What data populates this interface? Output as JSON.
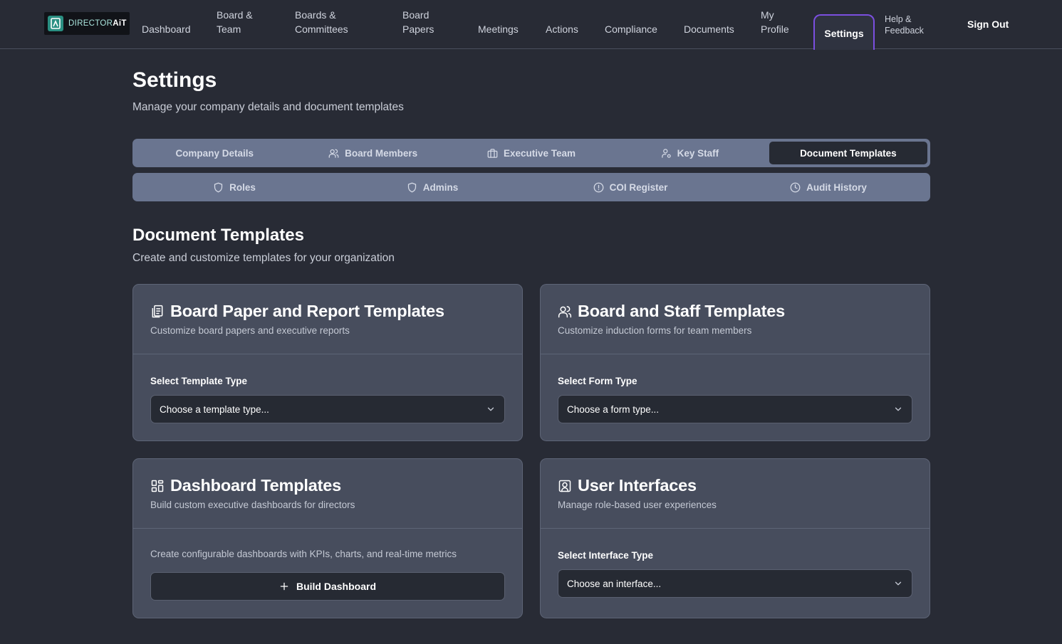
{
  "brand": {
    "logo_prefix": "DIRECTOR",
    "logo_suffix": "AiT"
  },
  "nav": {
    "dashboard": "Dashboard",
    "board_team": [
      "Board &",
      "Team"
    ],
    "boards_committees": [
      "Boards &",
      "Committees"
    ],
    "board_papers": [
      "Board",
      "Papers"
    ],
    "meetings": "Meetings",
    "actions": "Actions",
    "compliance": "Compliance",
    "documents": "Documents",
    "my_profile": [
      "My",
      "Profile"
    ],
    "settings": "Settings",
    "help_feedback": [
      "Help &",
      "Feedback"
    ],
    "sign_out": "Sign Out"
  },
  "header": {
    "title": "Settings",
    "subtitle": "Manage your company details and document templates"
  },
  "tabs_row1": [
    {
      "label": "Company Details",
      "icon": "none"
    },
    {
      "label": "Board Members",
      "icon": "users-icon"
    },
    {
      "label": "Executive Team",
      "icon": "briefcase-icon"
    },
    {
      "label": "Key Staff",
      "icon": "user-cog-icon"
    },
    {
      "label": "Document Templates",
      "icon": "none",
      "active": true
    }
  ],
  "tabs_row2": [
    {
      "label": "Roles",
      "icon": "shield-icon"
    },
    {
      "label": "Admins",
      "icon": "shield-icon"
    },
    {
      "label": "COI Register",
      "icon": "alert-circle-icon"
    },
    {
      "label": "Audit History",
      "icon": "clock-icon"
    }
  ],
  "section": {
    "title": "Document Templates",
    "subtitle": "Create and customize templates for your organization"
  },
  "cards": {
    "board_paper": {
      "title": "Board Paper and Report Templates",
      "subtitle": "Customize board papers and executive reports",
      "field_label": "Select Template Type",
      "select_value": "Choose a template type..."
    },
    "board_staff": {
      "title": "Board and Staff Templates",
      "subtitle": "Customize induction forms for team members",
      "field_label": "Select Form Type",
      "select_value": "Choose a form type..."
    },
    "dashboard": {
      "title": "Dashboard Templates",
      "subtitle": "Build custom executive dashboards for directors",
      "description": "Create configurable dashboards with KPIs, charts, and real-time metrics",
      "button_label": "Build Dashboard"
    },
    "user_interfaces": {
      "title": "User Interfaces",
      "subtitle": "Manage role-based user experiences",
      "field_label": "Select Interface Type",
      "select_value": "Choose an interface..."
    }
  },
  "colors": {
    "background": "#282b35",
    "card": "#474d5d",
    "tabbar": "#6a7590",
    "active_tab": "#262a33",
    "accent_purple": "#7b4fe0",
    "brand_teal": "#2a8f82"
  }
}
